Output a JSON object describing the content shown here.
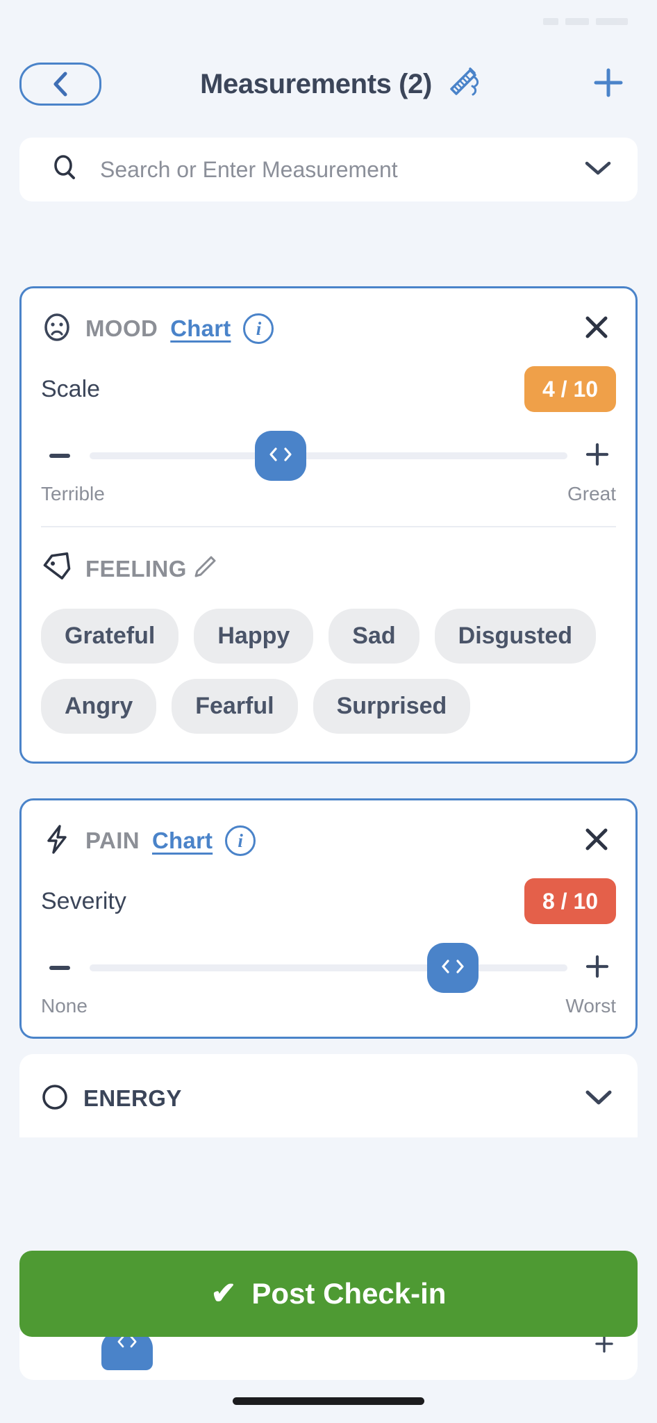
{
  "theme": {
    "page_bg": "#f2f5fa",
    "card_border": "#4a83c9",
    "accent_blue": "#4a83c9",
    "title_color": "#3b4559",
    "muted": "#8b8f99",
    "chip_bg": "#ebecee",
    "orange_badge": "#efa049",
    "red_badge": "#e4604a",
    "green_button": "#4e9a33"
  },
  "header": {
    "back_icon": "chevron-left-icon",
    "title": "Measurements (2)",
    "broom_icon": "broom-icon",
    "add_icon": "plus-icon"
  },
  "search": {
    "icon": "search-icon",
    "placeholder": "Search or Enter Measurement",
    "value": "",
    "dropdown_icon": "chevron-down-icon"
  },
  "cards": [
    {
      "icon": "sad-face-icon",
      "name": "MOOD",
      "chart_link": "Chart",
      "info_icon": "info-icon",
      "info_glyph": "i",
      "close_icon": "close-icon",
      "value_label": "Scale",
      "badge_text": "4 / 10",
      "badge_color": "#efa049",
      "value": 4,
      "min": 0,
      "max": 10,
      "thumb_icon": "left-right-arrows-icon",
      "minus_icon": "minus-icon",
      "plus_icon": "plus-icon",
      "low_label": "Terrible",
      "high_label": "Great",
      "tag_section": {
        "icon": "tag-icon",
        "name": "FEELING",
        "edit_icon": "pencil-icon",
        "chips": [
          "Grateful",
          "Happy",
          "Sad",
          "Disgusted",
          "Angry",
          "Fearful",
          "Surprised"
        ]
      }
    },
    {
      "icon": "lightning-bolt-icon",
      "name": "PAIN",
      "chart_link": "Chart",
      "info_icon": "info-icon",
      "info_glyph": "i",
      "close_icon": "close-icon",
      "value_label": "Severity",
      "badge_text": "8 / 10",
      "badge_color": "#e4604a",
      "value": 8,
      "min": 0,
      "max": 10,
      "thumb_icon": "left-right-arrows-icon",
      "minus_icon": "minus-icon",
      "plus_icon": "plus-icon",
      "low_label": "None",
      "high_label": "Worst"
    }
  ],
  "partial_card": {
    "icon": "energy-circle-icon",
    "name": "ENERGY",
    "collapse_icon": "chevron-down-icon"
  },
  "post_button": {
    "check_icon": "check-icon",
    "check_glyph": "✔",
    "label": "Post Check-in"
  }
}
